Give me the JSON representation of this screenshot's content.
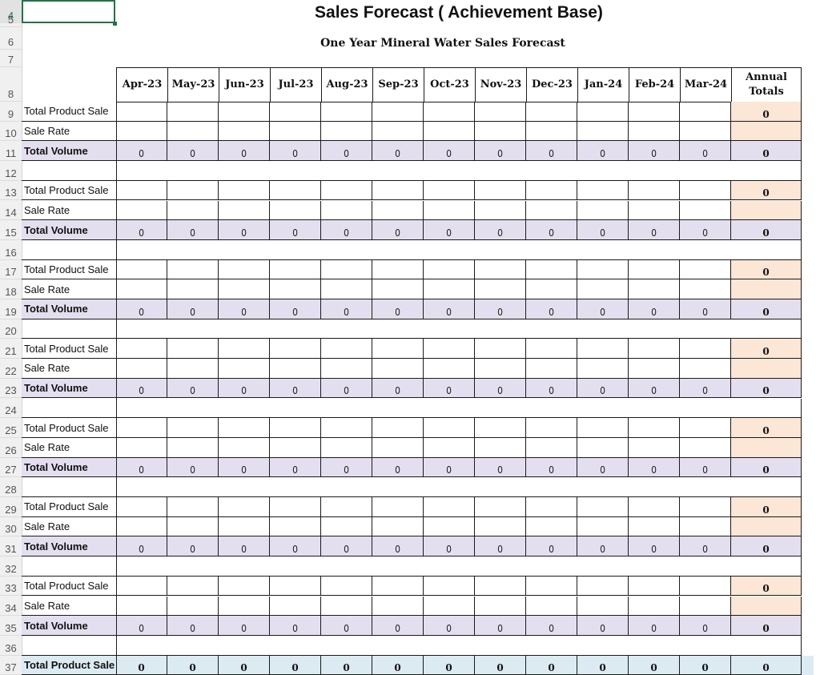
{
  "sheet": {
    "title": "Sales Forecast ( Achievement Base)",
    "subtitle": "One Year Mineral Water Sales Forecast",
    "selected_row": "4",
    "row_numbers": [
      "4",
      "5",
      "6",
      "7",
      "8",
      "9",
      "10",
      "11",
      "12",
      "13",
      "14",
      "15",
      "16",
      "17",
      "18",
      "19",
      "20",
      "21",
      "22",
      "23",
      "24",
      "25",
      "26",
      "27",
      "28",
      "29",
      "30",
      "31",
      "32",
      "33",
      "34",
      "35",
      "36",
      "37"
    ]
  },
  "table": {
    "months": [
      "Apr-23",
      "May-23",
      "Jun-23",
      "Jul-23",
      "Aug-23",
      "Sep-23",
      "Oct-23",
      "Nov-23",
      "Dec-23",
      "Jan-24",
      "Feb-24",
      "Mar-24"
    ],
    "annual_header_line1": "Annual",
    "annual_header_line2": "Totals",
    "row_labels": {
      "product_sale": "Total Product Sale",
      "sale_rate": "Sale Rate",
      "total_volume": "Total Volume"
    },
    "blocks": [
      {
        "annual_product_sale": "0",
        "volume": [
          "0",
          "0",
          "0",
          "0",
          "0",
          "0",
          "0",
          "0",
          "0",
          "0",
          "0",
          "0"
        ],
        "annual_volume": "0"
      },
      {
        "annual_product_sale": "0",
        "volume": [
          "0",
          "0",
          "0",
          "0",
          "0",
          "0",
          "0",
          "0",
          "0",
          "0",
          "0",
          "0"
        ],
        "annual_volume": "0"
      },
      {
        "annual_product_sale": "0",
        "volume": [
          "0",
          "0",
          "0",
          "0",
          "0",
          "0",
          "0",
          "0",
          "0",
          "0",
          "0",
          "0"
        ],
        "annual_volume": "0"
      },
      {
        "annual_product_sale": "0",
        "volume": [
          "0",
          "0",
          "0",
          "0",
          "0",
          "0",
          "0",
          "0",
          "0",
          "0",
          "0",
          "0"
        ],
        "annual_volume": "0"
      },
      {
        "annual_product_sale": "0",
        "volume": [
          "0",
          "0",
          "0",
          "0",
          "0",
          "0",
          "0",
          "0",
          "0",
          "0",
          "0",
          "0"
        ],
        "annual_volume": "0"
      },
      {
        "annual_product_sale": "0",
        "volume": [
          "0",
          "0",
          "0",
          "0",
          "0",
          "0",
          "0",
          "0",
          "0",
          "0",
          "0",
          "0"
        ],
        "annual_volume": "0"
      },
      {
        "annual_product_sale": "0",
        "volume": [
          "0",
          "0",
          "0",
          "0",
          "0",
          "0",
          "0",
          "0",
          "0",
          "0",
          "0",
          "0"
        ],
        "annual_volume": "0"
      }
    ],
    "grand_total": {
      "label": "Total Product Sale",
      "values": [
        "0",
        "0",
        "0",
        "0",
        "0",
        "0",
        "0",
        "0",
        "0",
        "0",
        "0",
        "0"
      ],
      "annual": "0"
    }
  },
  "colors": {
    "selection": "#217346",
    "volume_fill": "#e4dfee",
    "annual_fill": "#fce6d6",
    "grand_total_fill": "#dcebf2"
  }
}
